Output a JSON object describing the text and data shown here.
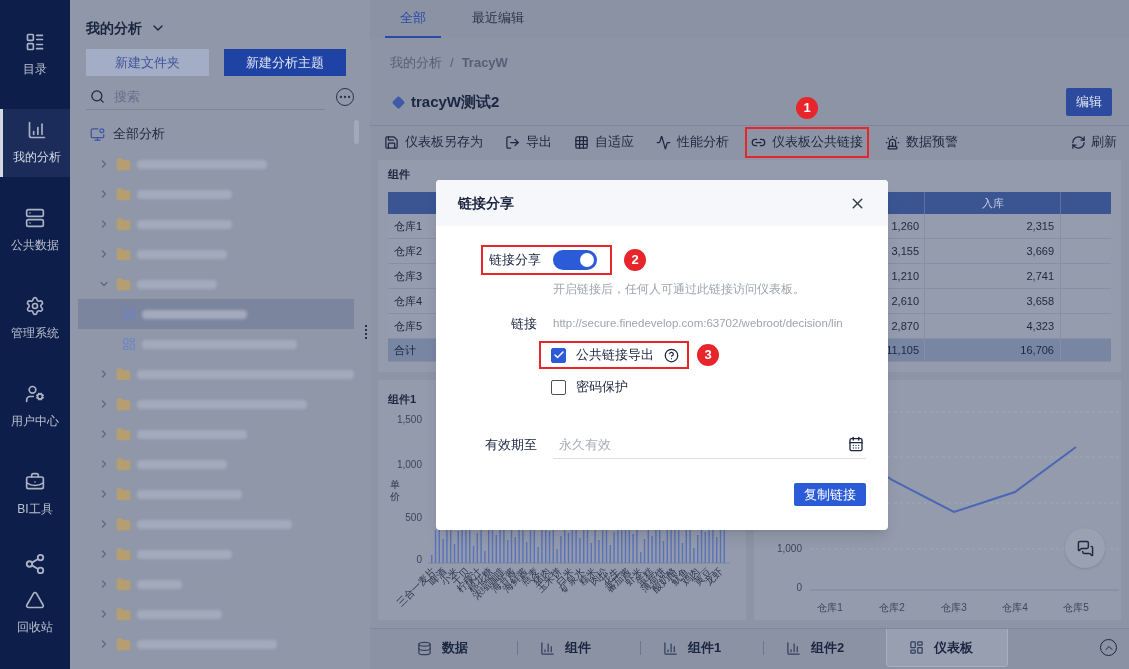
{
  "nav": [
    {
      "label": "目录",
      "selected": false
    },
    {
      "label": "我的分析",
      "selected": true
    },
    {
      "label": "公共数据",
      "selected": false
    },
    {
      "label": "管理系统",
      "selected": false
    },
    {
      "label": "用户中心",
      "selected": false
    },
    {
      "label": "BI工具",
      "selected": false
    },
    {
      "label": "回收站",
      "selected": false
    }
  ],
  "sidebar": {
    "title": "我的分析",
    "buttons": [
      {
        "label": "新建文件夹",
        "kind": "secondary"
      },
      {
        "label": "新建分析主题",
        "kind": "primary"
      }
    ],
    "search": {
      "placeholder": "搜索"
    },
    "root": "全部分析",
    "tree_items": [
      {
        "kind": "folder",
        "expanded": false,
        "selected": false
      },
      {
        "kind": "folder",
        "expanded": false,
        "selected": false
      },
      {
        "kind": "folder",
        "expanded": false,
        "selected": false
      },
      {
        "kind": "folder",
        "expanded": false,
        "selected": false
      },
      {
        "kind": "folder",
        "expanded": true,
        "selected": false,
        "children": [
          {
            "kind": "dashboard",
            "selected": true
          },
          {
            "kind": "dashboard",
            "selected": false
          }
        ]
      },
      {
        "kind": "folder",
        "expanded": false,
        "selected": false
      },
      {
        "kind": "folder",
        "expanded": false,
        "selected": false
      },
      {
        "kind": "folder",
        "expanded": false,
        "selected": false
      },
      {
        "kind": "folder",
        "expanded": false,
        "selected": false
      },
      {
        "kind": "folder",
        "expanded": false,
        "selected": false
      },
      {
        "kind": "folder",
        "expanded": false,
        "selected": false
      },
      {
        "kind": "folder",
        "expanded": false,
        "selected": false
      },
      {
        "kind": "folder",
        "expanded": false,
        "selected": false
      },
      {
        "kind": "folder",
        "expanded": false,
        "selected": false
      },
      {
        "kind": "folder",
        "expanded": false,
        "selected": false
      }
    ]
  },
  "main": {
    "tabs": [
      {
        "label": "全部",
        "selected": true
      },
      {
        "label": "最近编辑",
        "selected": false
      }
    ],
    "breadcrumb": [
      "我的分析",
      "TracyW"
    ],
    "breadcrumb_separator": "/",
    "title": "tracyW测试2",
    "edit_button": "编辑",
    "toolbar": [
      {
        "label": "仪表板另存为",
        "highlighted": false
      },
      {
        "label": "导出",
        "highlighted": false
      },
      {
        "label": "自适应",
        "highlighted": false
      },
      {
        "label": "性能分析",
        "highlighted": false
      },
      {
        "label": "仪表板公共链接",
        "highlighted": true,
        "badge": "1"
      },
      {
        "label": "数据预警",
        "highlighted": false
      }
    ],
    "refresh": "刷新"
  },
  "table_widget": {
    "title": "组件",
    "header": "入库",
    "rows": [
      {
        "name": "仓库1",
        "column_2": "1,260",
        "in_stock": "2,315",
        "kind": "row"
      },
      {
        "name": "仓库2",
        "column_2": "3,155",
        "in_stock": "3,669",
        "kind": "row"
      },
      {
        "name": "仓库3",
        "column_2": "1,210",
        "in_stock": "2,741",
        "kind": "row"
      },
      {
        "name": "仓库4",
        "column_2": "2,610",
        "in_stock": "3,658",
        "kind": "row"
      },
      {
        "name": "仓库5",
        "column_2": "2,870",
        "in_stock": "4,323",
        "kind": "row"
      },
      {
        "name": "合计",
        "column_2": "11,105",
        "in_stock": "16,706",
        "kind": "total"
      }
    ]
  },
  "bar_widget": {
    "title": "组件1",
    "ylabel": "单价",
    "yticks": [
      "1,500",
      "1,000",
      "500",
      "0"
    ],
    "x_labels": [
      "三合一麦片",
      "啤酒",
      "小米",
      "干贝",
      "柠檬汁",
      "棉花糖",
      "浓缩咖啡",
      "海苔酱",
      "海鲜酱",
      "燕麦",
      "猪肉",
      "玉米饼",
      "白米",
      "矿泉水",
      "糯米",
      "肉松",
      "花生",
      "蕃茄酱",
      "虾米",
      "蛋糕",
      "薄荷饼",
      "酸奶酪",
      "鱿鱼",
      "鸡肉",
      "黄豆",
      "龙虾"
    ]
  },
  "line_widget": {
    "yticks": [
      "1,000",
      "0"
    ],
    "x_labels": [
      "仓库1",
      "仓库2",
      "仓库3",
      "仓库4",
      "仓库5"
    ]
  },
  "bottom_tabs": [
    {
      "label": "数据",
      "kind": "data",
      "selected": false
    },
    {
      "label": "组件",
      "kind": "widget",
      "selected": false
    },
    {
      "label": "组件1",
      "kind": "widget",
      "selected": false
    },
    {
      "label": "组件2",
      "kind": "widget",
      "selected": false
    },
    {
      "label": "仪表板",
      "kind": "dashboard",
      "selected": true
    }
  ],
  "dialog": {
    "title": "链接分享",
    "share": {
      "label": "链接分享",
      "on": true,
      "highlighted": true,
      "badge": "2"
    },
    "hint": "开启链接后，任何人可通过此链接访问仪表板。",
    "link": {
      "label": "链接",
      "value": "http://secure.finedevelop.com:63702/webroot/decision/lin"
    },
    "options": [
      {
        "label": "公共链接导出",
        "checked": true,
        "help": true,
        "highlighted": true,
        "badge": "3"
      },
      {
        "label": "密码保护",
        "checked": false,
        "help": false,
        "highlighted": false
      }
    ],
    "expiry": {
      "label": "有效期至",
      "placeholder": "永久有效"
    },
    "copy_button": "复制链接"
  }
}
